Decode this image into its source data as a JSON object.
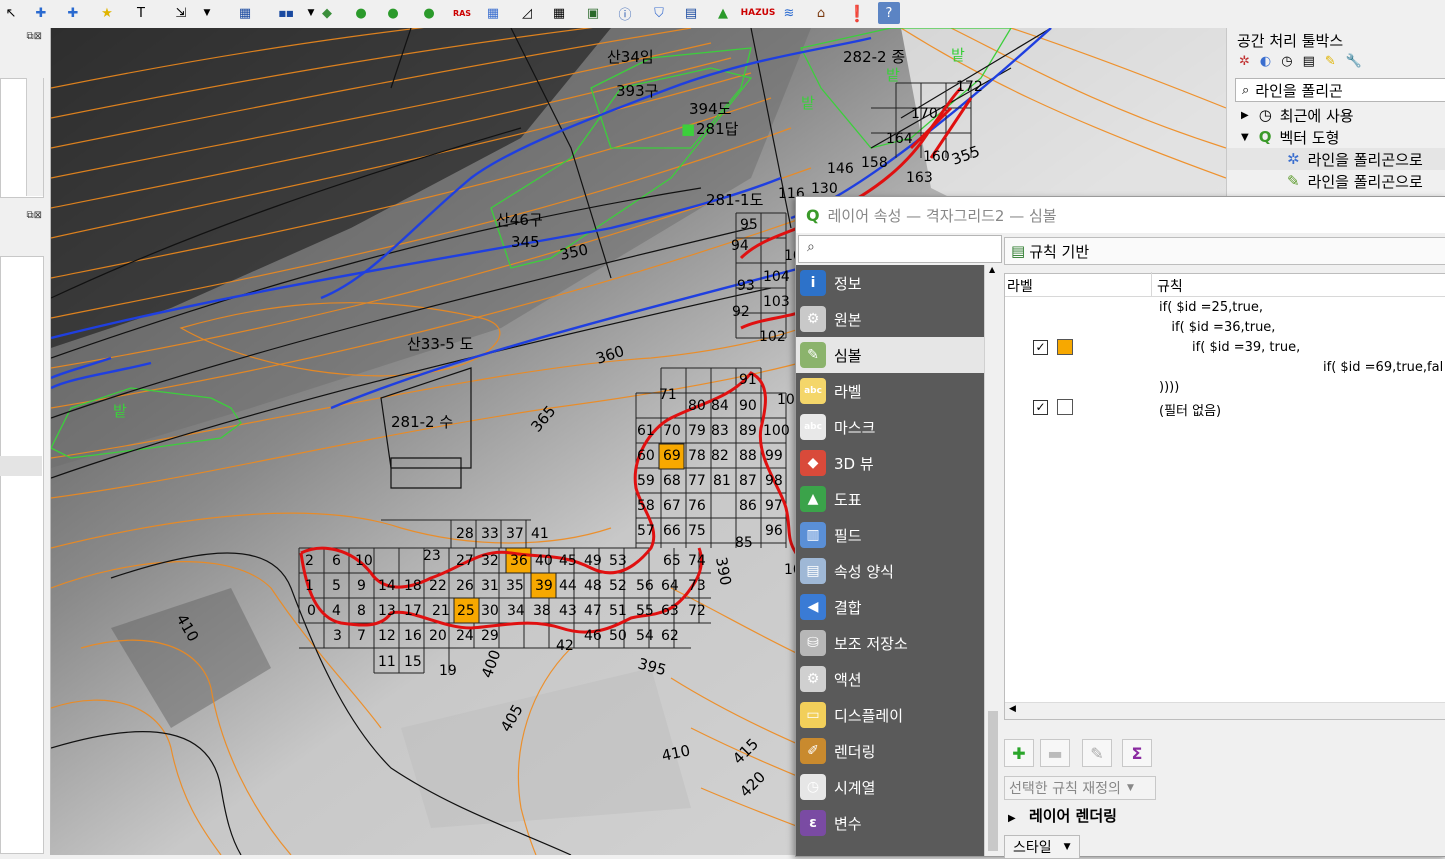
{
  "toolbar": {
    "raster_label": "RAS",
    "hazus_label": "HAZUS"
  },
  "map": {
    "labels": {
      "san34": "산34임",
      "lot393": "393구",
      "lot394": "394도",
      "lot281": "281답",
      "lot282": "282-2 종",
      "bat1": "밭",
      "bat2": "밭",
      "bat3": "밭",
      "bat4": "밭",
      "san46": "산46구",
      "c345": "345",
      "c350": "350",
      "lot2811": "281-1도",
      "san335": "산33-5 도",
      "c360": "360",
      "lot2812": "281-2 수",
      "c365": "365",
      "c355": "355",
      "c410": "410",
      "c400": "400",
      "c405": "405",
      "c395": "395",
      "c390": "390",
      "c410b": "410",
      "c415": "415",
      "c420": "420",
      "g172": "172",
      "g170": "170",
      "g164": "164",
      "g160": "160",
      "g146": "146",
      "g158": "158",
      "g163": "163",
      "g116": "116",
      "g130": "130",
      "g95": "95",
      "g94": "94",
      "g104": "104",
      "g93": "93",
      "g103": "103",
      "g92": "92",
      "g102": "102",
      "g10a": "10",
      "g10b": "10",
      "g10c": "10",
      "g85": "85",
      "g19": "19",
      "g23": "23",
      "g42": "42",
      "g71": "71"
    }
  },
  "toolbox": {
    "title": "공간 처리 툴박스",
    "search_value": "라인을 폴리곤",
    "items": [
      {
        "label": "최근에 사용"
      },
      {
        "label": "벡터 도형"
      },
      {
        "label": "라인을 폴리곤으로"
      },
      {
        "label": "라인을 폴리곤으로"
      }
    ]
  },
  "dialog": {
    "title": "레이어 속성 — 격자그리드2 — 심볼",
    "search_placeholder": "",
    "nav": [
      {
        "label": "정보",
        "icon": "info-icon",
        "color": "#2d72c9",
        "glyph": "i"
      },
      {
        "label": "원본",
        "icon": "source-wrench-icon",
        "color": "#c9c9c9",
        "glyph": "⚙"
      },
      {
        "label": "심볼",
        "icon": "paintbrush-icon",
        "color": "#8bb36c",
        "glyph": "✎"
      },
      {
        "label": "라벨",
        "icon": "label-abc-icon",
        "color": "#f4d66a",
        "glyph": "abc"
      },
      {
        "label": "마스크",
        "icon": "mask-abc-icon",
        "color": "#e8e8e8",
        "glyph": "abc"
      },
      {
        "label": "3D 뷰",
        "icon": "cube-3d-icon",
        "color": "#d94a3a",
        "glyph": "◆"
      },
      {
        "label": "도표",
        "icon": "diagram-icon",
        "color": "#3ba34a",
        "glyph": "▲"
      },
      {
        "label": "필드",
        "icon": "fields-icon",
        "color": "#5a8fd6",
        "glyph": "▥"
      },
      {
        "label": "속성 양식",
        "icon": "attribute-form-icon",
        "color": "#9fb8d6",
        "glyph": "▤"
      },
      {
        "label": "결합",
        "icon": "join-icon",
        "color": "#3a7bd5",
        "glyph": "◀"
      },
      {
        "label": "보조 저장소",
        "icon": "auxiliary-storage-icon",
        "color": "#b7b7b7",
        "glyph": "⛁"
      },
      {
        "label": "액션",
        "icon": "action-gear-icon",
        "color": "#d0d0d0",
        "glyph": "⚙"
      },
      {
        "label": "디스플레이",
        "icon": "display-bubble-icon",
        "color": "#f2cf5a",
        "glyph": "▭"
      },
      {
        "label": "렌더링",
        "icon": "rendering-brush-icon",
        "color": "#c98a2e",
        "glyph": "✐"
      },
      {
        "label": "시계열",
        "icon": "clock-icon",
        "color": "#e6e6e6",
        "glyph": "◷"
      },
      {
        "label": "변수",
        "icon": "variable-epsilon-icon",
        "color": "#7a4ba3",
        "glyph": "ε"
      }
    ],
    "renderer_type": "규칙 기반",
    "rules_header": {
      "label": "라벨",
      "rule": "규칙"
    },
    "rules": [
      {
        "line1": "if( $id =25,true,",
        "line2": "   if( $id =36,true,",
        "line3": "        if( $id =39, true,",
        "line4": "if( $id =69,true,fal",
        "line5": "))))",
        "color": "#f7a800",
        "checked": "✓"
      },
      {
        "line1": "(필터 없음)",
        "color": "#ffffff",
        "checked": "✓"
      }
    ],
    "refine_label": "선택한 규칙 재정의",
    "layer_rendering_label": "레이어 렌더링",
    "style_label": "스타일"
  }
}
